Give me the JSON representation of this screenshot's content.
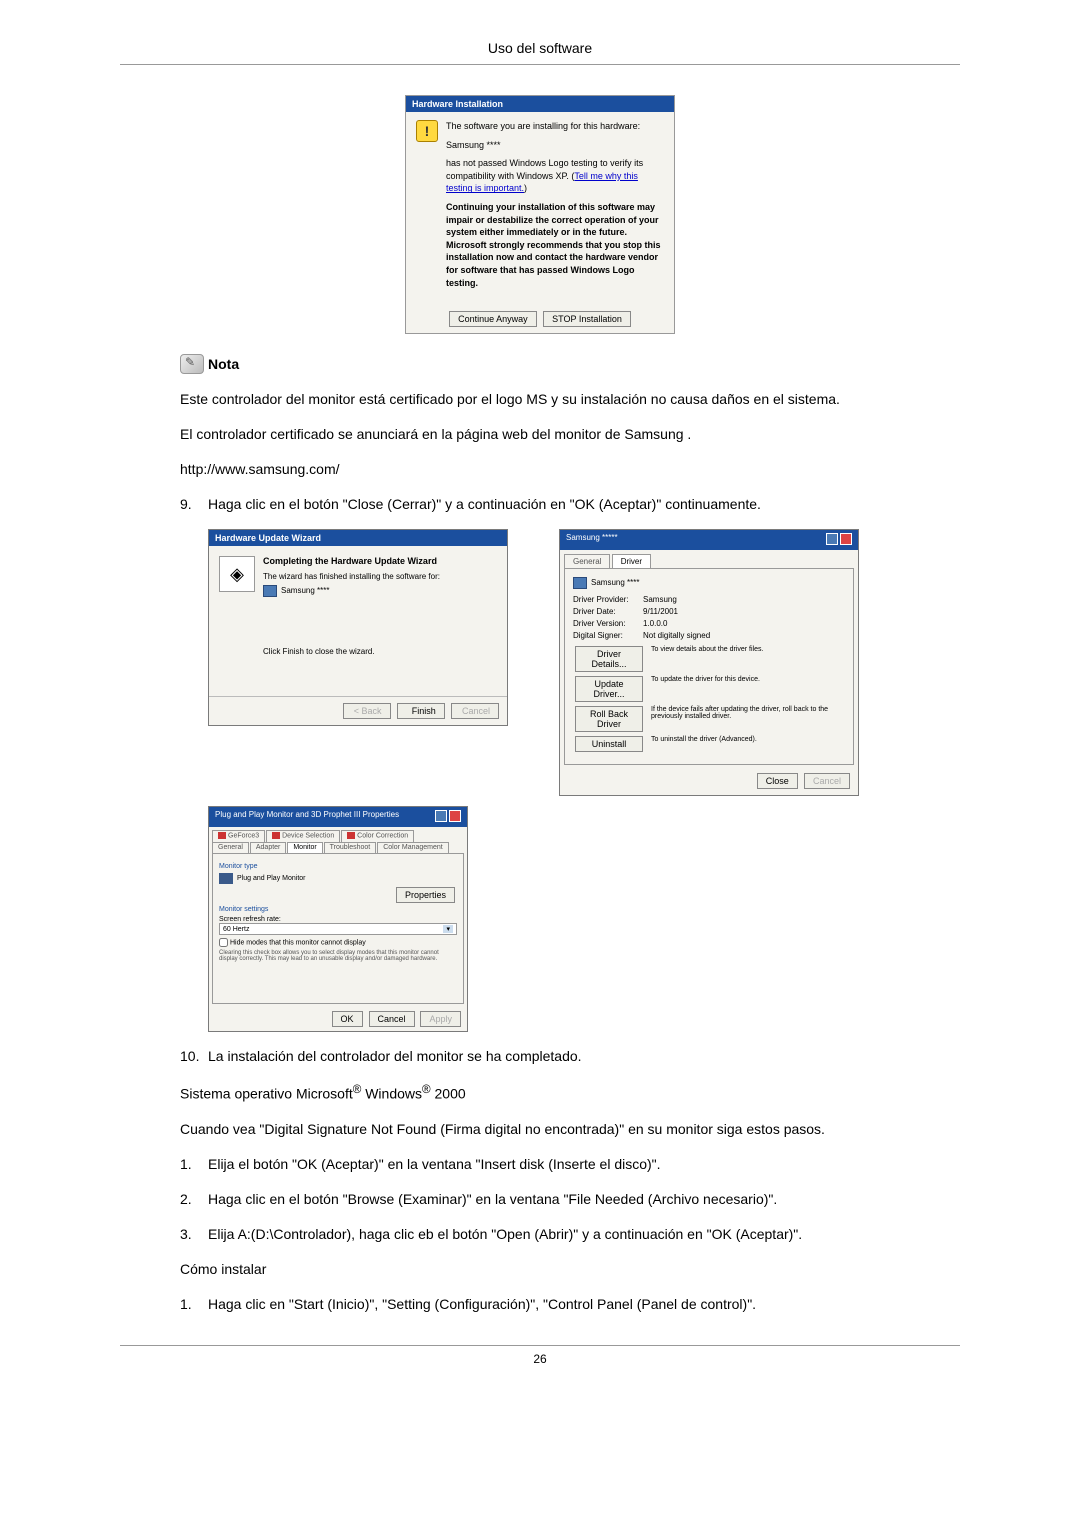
{
  "header": {
    "title": "Uso del software"
  },
  "hw_install": {
    "title": "Hardware Installation",
    "line1": "The software you are installing for this hardware:",
    "device": "Samsung ****",
    "line2a": "has not passed Windows Logo testing to verify its compatibility with Windows XP. (",
    "link": "Tell me why this testing is important.",
    "line2b": ")",
    "warning": "Continuing your installation of this software may impair or destabilize the correct operation of your system either immediately or in the future. Microsoft strongly recommends that you stop this installation now and contact the hardware vendor for software that has passed Windows Logo testing.",
    "continue_btn": "Continue Anyway",
    "stop_btn": "STOP Installation"
  },
  "note": {
    "label": "Nota",
    "text1": "Este controlador del monitor está certificado por el logo MS y su instalación no causa daños en el sistema.",
    "text2": "El controlador certificado se anunciará en la página web del monitor de Samsung .",
    "url": "http://www.samsung.com/"
  },
  "step9": {
    "num": "9.",
    "text": "Haga clic en el botón \"Close (Cerrar)\" y a continuación en \"OK (Aceptar)\" continuamente."
  },
  "wizard": {
    "title": "Hardware Update Wizard",
    "heading": "Completing the Hardware Update Wizard",
    "line1": "The wizard has finished installing the software for:",
    "device": "Samsung ****",
    "finish_hint": "Click Finish to close the wizard.",
    "back": "< Back",
    "finish": "Finish",
    "cancel": "Cancel"
  },
  "driver_props": {
    "title": "Samsung *****",
    "tab_general": "General",
    "tab_driver": "Driver",
    "device": "Samsung ****",
    "provider_label": "Driver Provider:",
    "provider_value": "Samsung",
    "date_label": "Driver Date:",
    "date_value": "9/11/2001",
    "version_label": "Driver Version:",
    "version_value": "1.0.0.0",
    "signer_label": "Digital Signer:",
    "signer_value": "Not digitally signed",
    "details_btn": "Driver Details...",
    "details_desc": "To view details about the driver files.",
    "update_btn": "Update Driver...",
    "update_desc": "To update the driver for this device.",
    "rollback_btn": "Roll Back Driver",
    "rollback_desc": "If the device fails after updating the driver, roll back to the previously installed driver.",
    "uninstall_btn": "Uninstall",
    "uninstall_desc": "To uninstall the driver (Advanced).",
    "close": "Close",
    "cancel": "Cancel"
  },
  "monitor_props": {
    "title": "Plug and Play Monitor and 3D Prophet III Properties",
    "tabs": {
      "geforce": "GeForce3",
      "device_sel": "Device Selection",
      "color_corr": "Color Correction",
      "general": "General",
      "adapter": "Adapter",
      "monitor": "Monitor",
      "troubleshoot": "Troubleshoot",
      "color_mgmt": "Color Management"
    },
    "section_type": "Monitor type",
    "item_name": "Plug and Play Monitor",
    "properties_btn": "Properties",
    "section_settings": "Monitor settings",
    "refresh_label": "Screen refresh rate:",
    "refresh_value": "60 Hertz",
    "hide_checkbox": "Hide modes that this monitor cannot display",
    "hide_desc": "Clearing this check box allows you to select display modes that this monitor cannot display correctly. This may lead to an unusable display and/or damaged hardware.",
    "ok": "OK",
    "cancel": "Cancel",
    "apply": "Apply"
  },
  "step10": {
    "num": "10.",
    "text": "La instalación del controlador del monitor se ha completado."
  },
  "os_line_a": "Sistema operativo Microsoft",
  "os_line_b": " Windows",
  "os_line_c": " 2000",
  "sig_para": "Cuando vea \"Digital Signature Not Found (Firma digital no encontrada)\" en su monitor siga estos pasos.",
  "sig_steps": {
    "s1_num": "1.",
    "s1_text": "Elija el botón \"OK (Aceptar)\" en la ventana \"Insert disk (Inserte el disco)\".",
    "s2_num": "2.",
    "s2_text": "Haga clic en el botón \"Browse (Examinar)\" en la ventana \"File Needed (Archivo necesario)\".",
    "s3_num": "3.",
    "s3_text": "Elija A:(D:\\Controlador), haga clic eb el botón \"Open (Abrir)\" y a continuación en \"OK (Aceptar)\"."
  },
  "install_heading": "Cómo instalar",
  "install_step1": {
    "num": "1.",
    "text": "Haga clic en \"Start (Inicio)\", \"Setting (Configuración)\", \"Control Panel (Panel de control)\"."
  },
  "page_number": "26"
}
